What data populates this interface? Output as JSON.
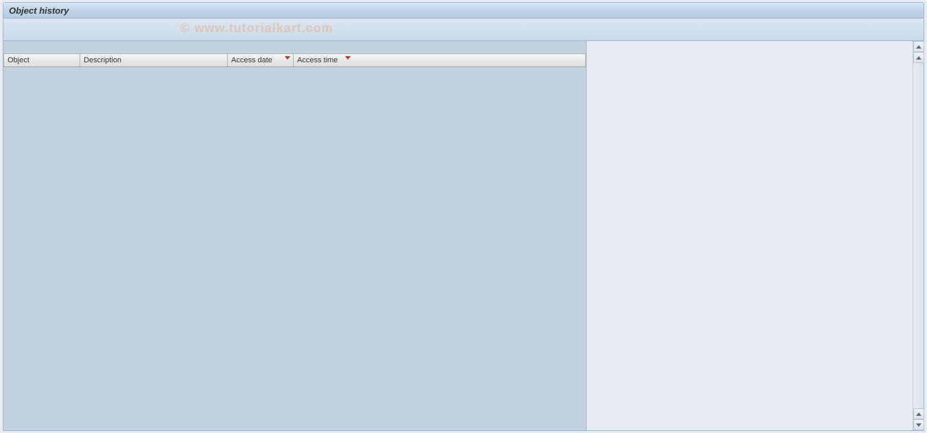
{
  "titlebar": {
    "title": "Object history"
  },
  "watermark": "© www.tutorialkart.com",
  "table": {
    "columns": [
      {
        "label": "Object",
        "sorted": false
      },
      {
        "label": "Description",
        "sorted": false
      },
      {
        "label": "Access date",
        "sorted": true
      },
      {
        "label": "Access time",
        "sorted": true
      }
    ],
    "rows": []
  }
}
